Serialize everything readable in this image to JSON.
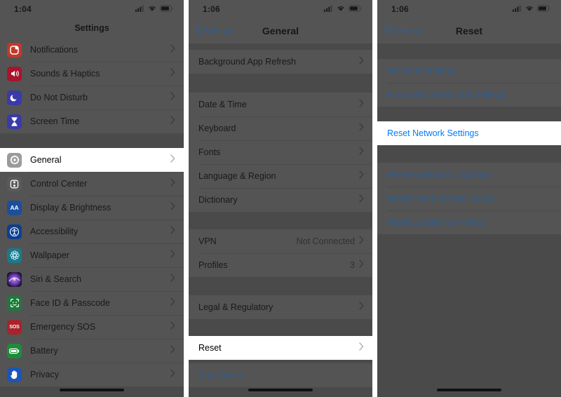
{
  "panels": [
    {
      "name": "settings-root",
      "status": {
        "time": "1:04",
        "cellular": "signal-bars-icon",
        "wifi": "wifi-icon",
        "battery": "battery-icon"
      },
      "nav": {
        "title": "Settings",
        "back": null
      },
      "groups": [
        {
          "rows": [
            {
              "label": "Notifications",
              "icon": "notifications-icon",
              "chevron": true,
              "highlight": false
            },
            {
              "label": "Sounds & Haptics",
              "icon": "sounds-haptics-icon",
              "chevron": true,
              "highlight": false
            },
            {
              "label": "Do Not Disturb",
              "icon": "do-not-disturb-icon",
              "chevron": true,
              "highlight": false
            },
            {
              "label": "Screen Time",
              "icon": "screen-time-icon",
              "chevron": true,
              "highlight": false
            }
          ]
        },
        {
          "rows": [
            {
              "label": "General",
              "icon": "general-gear-icon",
              "chevron": true,
              "highlight": true
            },
            {
              "label": "Control Center",
              "icon": "control-center-icon",
              "chevron": true,
              "highlight": false
            },
            {
              "label": "Display & Brightness",
              "icon": "display-brightness-icon",
              "chevron": true,
              "highlight": false
            },
            {
              "label": "Accessibility",
              "icon": "accessibility-icon",
              "chevron": true,
              "highlight": false
            },
            {
              "label": "Wallpaper",
              "icon": "wallpaper-icon",
              "chevron": true,
              "highlight": false
            },
            {
              "label": "Siri & Search",
              "icon": "siri-search-icon",
              "chevron": true,
              "highlight": false
            },
            {
              "label": "Face ID & Passcode",
              "icon": "face-id-icon",
              "chevron": true,
              "highlight": false
            },
            {
              "label": "Emergency SOS",
              "icon": "emergency-sos-icon",
              "chevron": true,
              "highlight": false
            },
            {
              "label": "Battery",
              "icon": "battery-settings-icon",
              "chevron": true,
              "highlight": false
            },
            {
              "label": "Privacy",
              "icon": "privacy-hand-icon",
              "chevron": true,
              "highlight": false
            }
          ]
        }
      ]
    },
    {
      "name": "general-settings",
      "status": {
        "time": "1:06",
        "cellular": "signal-bars-icon",
        "wifi": "wifi-icon",
        "battery": "battery-icon"
      },
      "nav": {
        "title": "General",
        "back": "Settings"
      },
      "groups": [
        {
          "rows": [
            {
              "label": "Background App Refresh",
              "chevron": true,
              "highlight": false
            }
          ]
        },
        {
          "rows": [
            {
              "label": "Date & Time",
              "chevron": true,
              "highlight": false
            },
            {
              "label": "Keyboard",
              "chevron": true,
              "highlight": false
            },
            {
              "label": "Fonts",
              "chevron": true,
              "highlight": false
            },
            {
              "label": "Language & Region",
              "chevron": true,
              "highlight": false
            },
            {
              "label": "Dictionary",
              "chevron": true,
              "highlight": false
            }
          ]
        },
        {
          "rows": [
            {
              "label": "VPN",
              "value": "Not Connected",
              "chevron": true,
              "highlight": false
            },
            {
              "label": "Profiles",
              "value": "3",
              "chevron": true,
              "highlight": false
            }
          ]
        },
        {
          "rows": [
            {
              "label": "Legal & Regulatory",
              "chevron": true,
              "highlight": false
            }
          ]
        },
        {
          "rows": [
            {
              "label": "Reset",
              "chevron": true,
              "highlight": true
            }
          ]
        },
        {
          "rows": [
            {
              "label": "Shut Down",
              "chevron": false,
              "highlight": false,
              "link": true
            }
          ]
        }
      ]
    },
    {
      "name": "reset-settings",
      "status": {
        "time": "1:06",
        "cellular": "signal-bars-icon",
        "wifi": "wifi-icon",
        "battery": "battery-icon"
      },
      "nav": {
        "title": "Reset",
        "back": "General"
      },
      "groups": [
        {
          "rows": [
            {
              "label": "Reset All Settings",
              "chevron": false,
              "highlight": false,
              "link": true
            },
            {
              "label": "Erase All Content and Settings",
              "chevron": false,
              "highlight": false,
              "link": true
            }
          ]
        },
        {
          "rows": [
            {
              "label": "Reset Network Settings",
              "chevron": false,
              "highlight": true,
              "link": true
            }
          ]
        },
        {
          "rows": [
            {
              "label": "Reset Keyboard Dictionary",
              "chevron": false,
              "highlight": false,
              "link": true
            },
            {
              "label": "Reset Home Screen Layout",
              "chevron": false,
              "highlight": false,
              "link": true
            },
            {
              "label": "Reset Location & Privacy",
              "chevron": false,
              "highlight": false,
              "link": true
            }
          ]
        }
      ]
    }
  ],
  "colors": {
    "accent_blue": "#007aff",
    "dim_blue": "#2f5d90",
    "dim_list_bg": "#545454",
    "dim_group_bg": "#4a4a4a",
    "highlight_bg": "#ffffff",
    "notifications": "#c0392b",
    "sounds": "#a8142b",
    "dnd": "#3a3aa8",
    "screen_time": "#3a3aa8",
    "general": "#9b9b9b",
    "control_center": "#4a4a4a",
    "display": "#1b4f9c",
    "accessibility": "#0d3f8f",
    "wallpaper": "#1a7a8c",
    "siri": "#2a1840",
    "faceid": "#1d7a3a",
    "sos": "#a8232b",
    "battery": "#1d8c3a",
    "privacy": "#1b55b5"
  }
}
